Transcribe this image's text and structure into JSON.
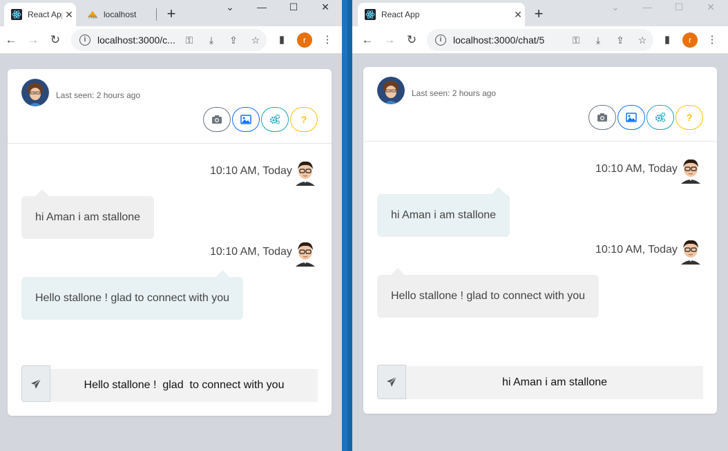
{
  "left": {
    "tabs": [
      {
        "title": "React App",
        "favicon": "react-icon"
      },
      {
        "title": "localhost",
        "favicon": "pma-icon"
      }
    ],
    "url": "localhost:3000/c...",
    "profile_initial": "r",
    "chat": {
      "last_seen": "Last seen: 2 hours ago",
      "messages": [
        {
          "time": "10:10 AM, Today",
          "text": "hi Aman i am stallone"
        },
        {
          "time": "10:10 AM, Today",
          "text": "Hello stallone ! glad to connect with you"
        }
      ],
      "input_value": "Hello stallone !  glad  to connect with you"
    }
  },
  "right": {
    "tabs": [
      {
        "title": "React App",
        "favicon": "react-icon"
      }
    ],
    "url": "localhost:3000/chat/5",
    "profile_initial": "r",
    "chat": {
      "last_seen": "Last seen: 2 hours ago",
      "messages": [
        {
          "time": "10:10 AM, Today",
          "text": "hi Aman i am stallone"
        },
        {
          "time": "10:10 AM, Today",
          "text": "Hello stallone ! glad to connect with you"
        }
      ],
      "input_value": "hi Aman i am stallone"
    }
  },
  "action_buttons": [
    {
      "icon": "camera-icon",
      "color": "#6c757d"
    },
    {
      "icon": "image-icon",
      "color": "#0d6efd"
    },
    {
      "icon": "cogs-icon",
      "color": "#17a2b8"
    },
    {
      "icon": "question-icon",
      "color": "#ffc107",
      "glyph": "?"
    }
  ],
  "colors": {
    "page_bg": "#d3d6dd",
    "desktop_accent": "#1e73be",
    "bubble_grey": "#efefef",
    "bubble_blue": "#e8f1f3",
    "profile_badge": "#e8710a"
  }
}
